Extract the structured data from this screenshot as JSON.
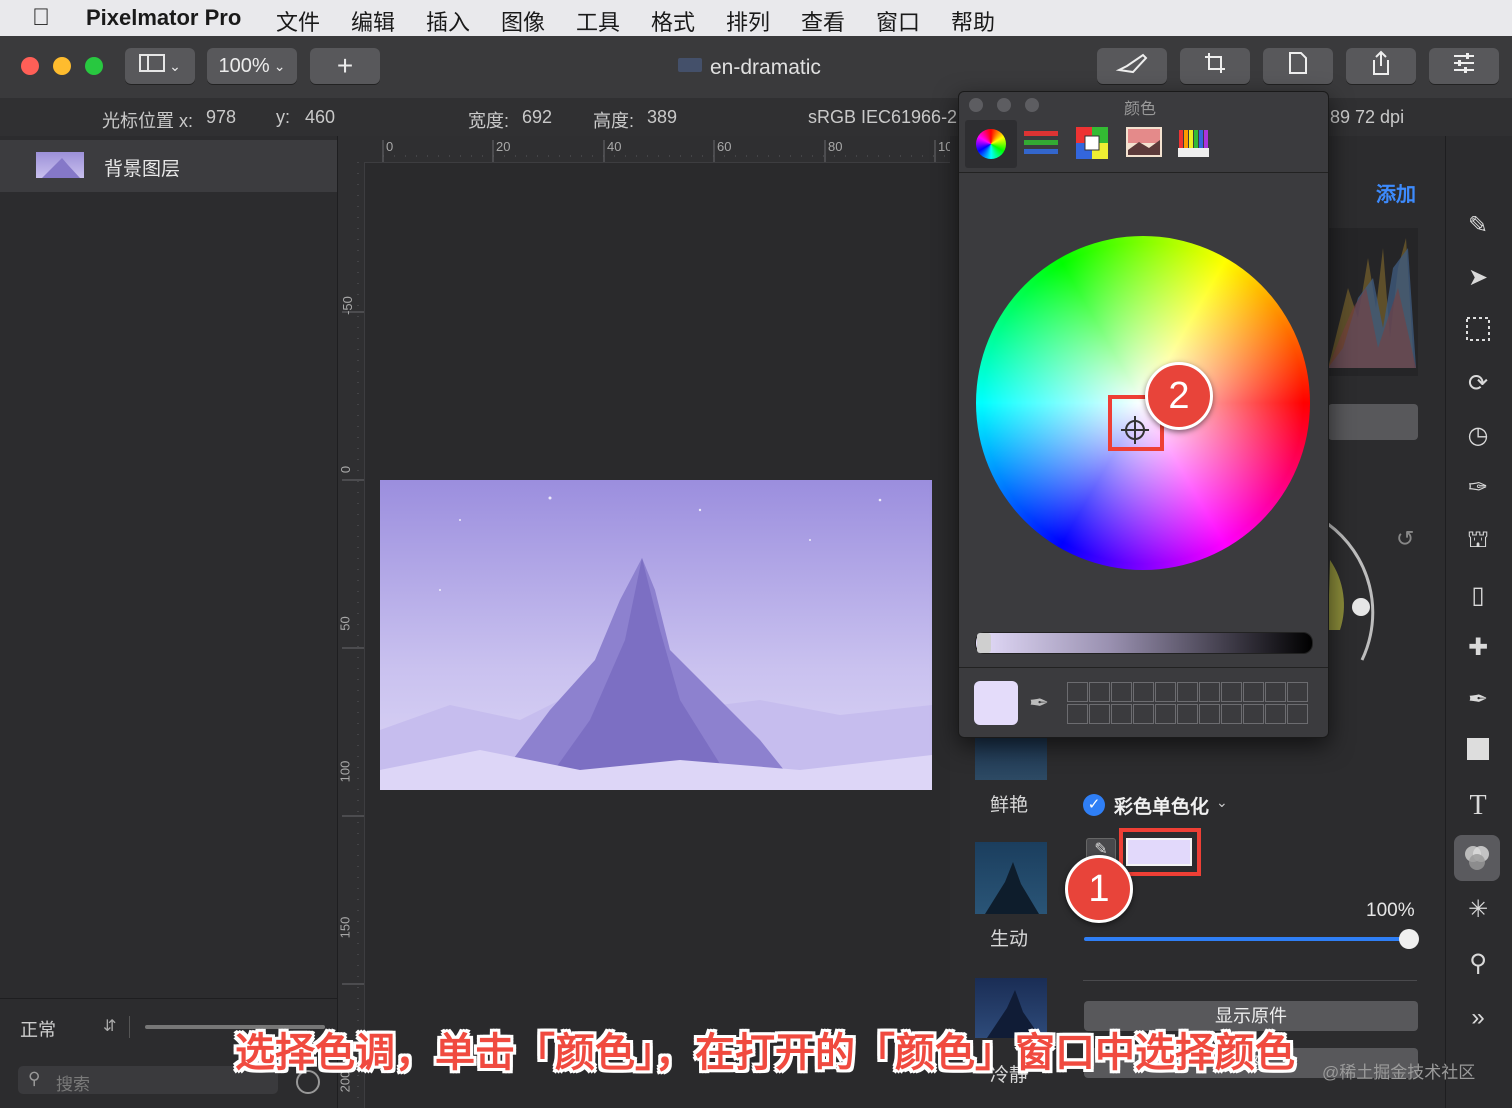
{
  "menubar": {
    "app_name": "Pixelmator Pro",
    "items": [
      "文件",
      "编辑",
      "插入",
      "图像",
      "工具",
      "格式",
      "排列",
      "查看",
      "窗口",
      "帮助"
    ]
  },
  "toolbar": {
    "zoom": "100%",
    "add_label": "+",
    "document_title": "en-dramatic"
  },
  "infobar": {
    "cursor_x_label": "光标位置 x:",
    "cursor_x": "978",
    "cursor_y_label": "y:",
    "cursor_y": "460",
    "width_label": "宽度:",
    "width": "692",
    "height_label": "高度:",
    "height": "389",
    "color_profile": "sRGB IEC61966-2",
    "resolution": "89 72 dpi"
  },
  "layers": {
    "items": [
      {
        "name": "背景图层"
      }
    ],
    "blend_mode": "正常",
    "search_placeholder": "搜索"
  },
  "rulers": {
    "top": [
      "0",
      "20",
      "40",
      "60",
      "80",
      "10"
    ],
    "left": [
      "-50",
      "0",
      "50",
      "100",
      "150",
      "200"
    ]
  },
  "color_window": {
    "title": "颜色",
    "tabs": [
      "color-wheel",
      "color-sliders",
      "color-palettes",
      "image-palettes",
      "pencils"
    ],
    "selected_color": "#e4dcfa"
  },
  "adjustments": {
    "add_label": "添加",
    "preset_vivid": "鲜艳",
    "preset_lively": "生动",
    "preset_calm": "冷静",
    "colorize_label": "彩色单色化",
    "colorize_enabled": true,
    "swatch_color": "#e2d9fb",
    "intensity": "100%",
    "show_original": "显示原件",
    "reset_partial": "整"
  },
  "callouts": {
    "one": "1",
    "two": "2"
  },
  "caption": "选择色调，单击「颜色」，在打开的「颜色」窗口中选择颜色",
  "watermark": "@稀土掘金技术社区"
}
